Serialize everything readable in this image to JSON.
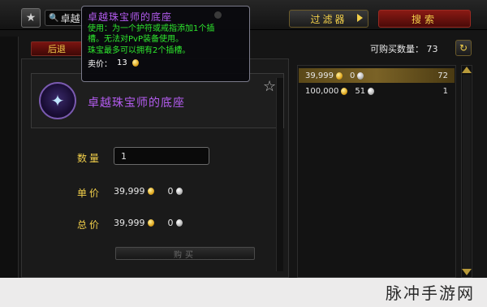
{
  "header": {
    "search_value": "卓越",
    "filter_label": "过滤器",
    "search_label": "搜索"
  },
  "toolbar": {
    "back_label": "后退",
    "purchasable_label": "可购买数量：",
    "purchasable_count": "73"
  },
  "tooltip": {
    "title": "卓越珠宝师的底座",
    "use_line1": "使用：为一个护符或戒指添加1个插",
    "use_line2": "槽。无法对PvP装备使用。",
    "unique_line": "珠宝最多可以拥有2个插槽。",
    "sell_label": "卖价：",
    "sell_value": "13"
  },
  "item": {
    "name": "卓越珠宝师的底座"
  },
  "purchase": {
    "quantity_label": "数量",
    "quantity_value": "1",
    "unit_price_label": "单价",
    "unit_gold": "39,999",
    "unit_silver": "0",
    "total_label": "总价",
    "total_gold": "39,999",
    "total_silver": "0",
    "buy_label": "购买"
  },
  "listings": [
    {
      "gold": "39,999",
      "silver": "0",
      "quantity": "72",
      "selected": true
    },
    {
      "gold": "100,000",
      "silver": "51",
      "quantity": "1",
      "selected": false
    }
  ],
  "watermark": "脉冲手游网",
  "colors": {
    "accent_gold": "#f2cf4a",
    "item_purple": "#b45cf0",
    "tooltip_green": "#2ee82e",
    "button_red": "#8a1a14"
  },
  "icons": {
    "favorite": "star-icon",
    "search": "magnifier-icon",
    "refresh": "refresh-icon",
    "coin_gold": "gold-coin-icon",
    "coin_silver": "silver-coin-icon"
  }
}
